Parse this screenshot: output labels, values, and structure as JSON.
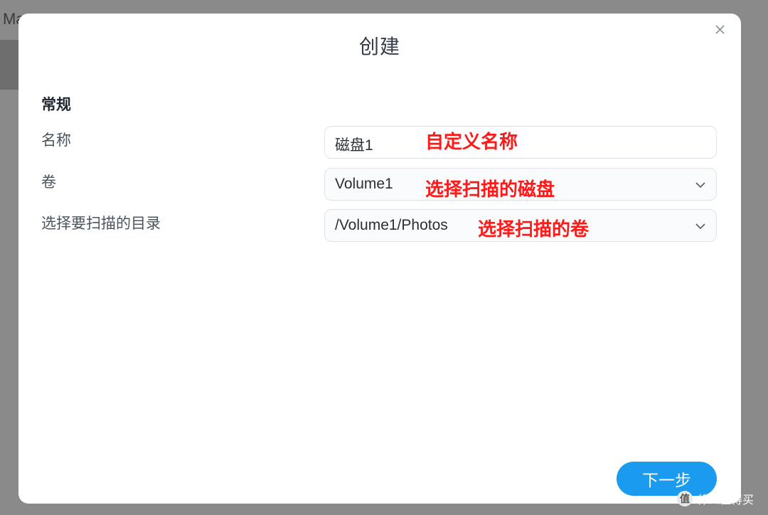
{
  "background": {
    "app_title": "Manager"
  },
  "dialog": {
    "title": "创建",
    "section_title": "常规",
    "fields": [
      {
        "label": "名称",
        "value": "磁盘1",
        "annotation": "自定义名称"
      },
      {
        "label": "卷",
        "value": "Volume1",
        "annotation": "选择扫描的磁盘"
      },
      {
        "label": "选择要扫描的目录",
        "value": "/Volume1/Photos",
        "annotation": "选择扫描的卷"
      }
    ],
    "next_button": "下一步"
  },
  "watermark": {
    "logo_char": "值",
    "text": "什么值得买"
  },
  "colors": {
    "annotation": "#ff1a1a",
    "primary_button": "#1a9bf0"
  }
}
